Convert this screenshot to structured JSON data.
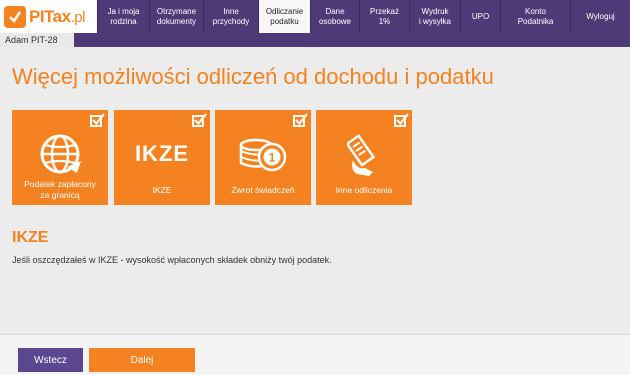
{
  "brand": {
    "logo_text": "PITax",
    "logo_suffix": ".pl",
    "color": "#f58220",
    "nav_bg": "#4f3a78"
  },
  "nav": [
    {
      "label": "Ja i moja\nrodzina",
      "active": false
    },
    {
      "label": "Otrzymane\ndokumenty",
      "active": false
    },
    {
      "label": "Inne\nprzychody",
      "active": false
    },
    {
      "label": "Odliczanie\npodatku",
      "active": true
    },
    {
      "label": "Dane\nosobowe",
      "active": false
    },
    {
      "label": "Przekaż\n1%",
      "active": false
    },
    {
      "label": "Wydruk\ni wysyłka",
      "active": false
    },
    {
      "label": "UPO",
      "active": false
    },
    {
      "label": "Konto\nPodatnika",
      "active": false
    },
    {
      "label": "Wyloguj",
      "active": false
    }
  ],
  "subtab": {
    "label": "Adam PIT-28"
  },
  "page_title": "Więcej możliwości odliczeń od dochodu i podatku",
  "tiles": [
    {
      "label": "Podatek zapłacony\nza granicą",
      "icon": "globe-icon",
      "checked": true
    },
    {
      "label": "IKZE",
      "icon": "ikze-text-icon",
      "icon_text": "IKZE",
      "checked": true
    },
    {
      "label": "Zwrot świadczeń",
      "icon": "coins-icon",
      "checked": true
    },
    {
      "label": "Inne odliczenia",
      "icon": "money-icon",
      "checked": true
    }
  ],
  "section": {
    "title": "IKZE",
    "description": "Jeśli oszczędzałeś w IKZE - wysokość wpłaconych składek obniży twój podatek."
  },
  "footer": {
    "back_label": "Wstecz",
    "next_label": "Dalej"
  }
}
